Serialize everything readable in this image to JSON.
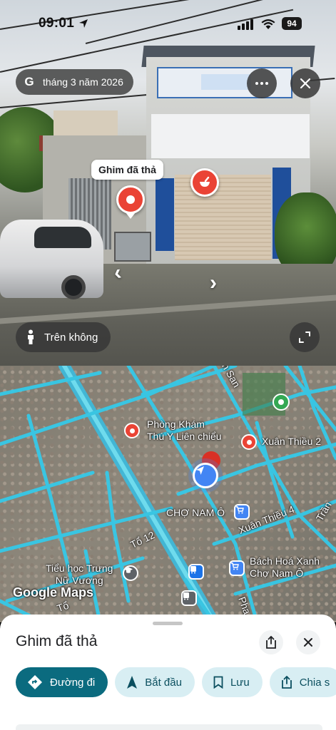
{
  "status_bar": {
    "time": "09:01",
    "battery": "94"
  },
  "street_view": {
    "date_chip": "tháng 3 năm 2026",
    "dropped_pin_label": "Ghim đã thả",
    "aerial_label": "Trên không"
  },
  "map": {
    "labels": {
      "clinic": "Phòng Khám\nThú Y Liên chiểu",
      "xuan_thieu_2": "Xuân Thiều 2",
      "cho_nam_o": "CHỢ NAM Ô",
      "xuan_thieu_4": "Xuân Thiều 4",
      "bach_hoa_xanh": "Bách Hoá Xanh\nChợ Nam Ô",
      "to_12": "Tổ 12",
      "tieu_hoc": "Tiểu học Trưng\nNữ Vương",
      "to_bottom": "Tổ",
      "road_top": "ch San",
      "road_right": "Trần",
      "road_pha": "Pha",
      "logo": "Google Maps"
    }
  },
  "sheet": {
    "title": "Ghim đã thả",
    "actions": {
      "directions": "Đường đi",
      "start": "Bắt đầu",
      "save": "Lưu",
      "share": "Chia s"
    }
  },
  "colors": {
    "primary_action": "#0b6b7f",
    "secondary_action": "#d8eef3",
    "pin_red": "#ea4335",
    "road_cyan": "#35c9e8",
    "user_blue": "#4285f4"
  }
}
